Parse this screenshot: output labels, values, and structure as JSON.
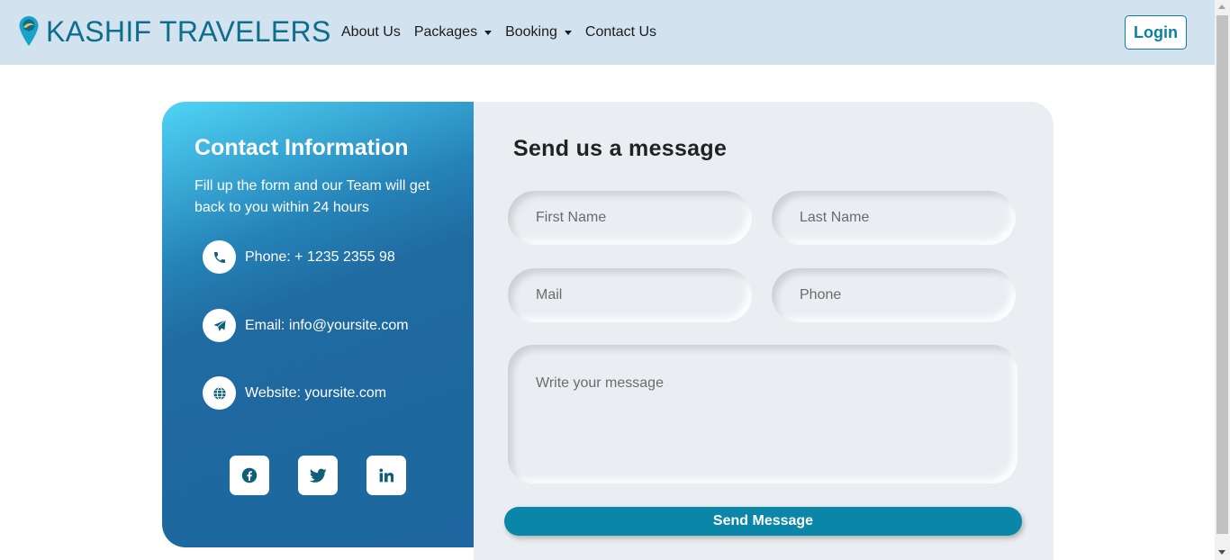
{
  "navbar": {
    "brand": "KASHIF TRAVELERS",
    "links": [
      {
        "label": "About Us"
      },
      {
        "label": "Packages"
      },
      {
        "label": "Booking"
      },
      {
        "label": "Contact Us"
      }
    ],
    "login": "Login"
  },
  "contact_info": {
    "title": "Contact Information",
    "description": "Fill up the form and our Team will get back to you within 24 hours",
    "phone": "Phone: + 1235 2355 98",
    "email": "Email: info@yoursite.com",
    "website": "Website: yoursite.com",
    "social": [
      "facebook-icon",
      "twitter-icon",
      "linkedin-icon"
    ]
  },
  "form": {
    "title": "Send us a message",
    "first_name_placeholder": "First Name",
    "last_name_placeholder": "Last Name",
    "mail_placeholder": "Mail",
    "phone_placeholder": "Phone",
    "message_placeholder": "Write your message",
    "submit": "Send Message"
  },
  "colors": {
    "accent": "#0a86a8",
    "brand": "#0d6e8c",
    "navbar_bg": "#d3e2ef",
    "panel_dark": "#1e67a0",
    "panel_light": "#4fd4f7"
  }
}
